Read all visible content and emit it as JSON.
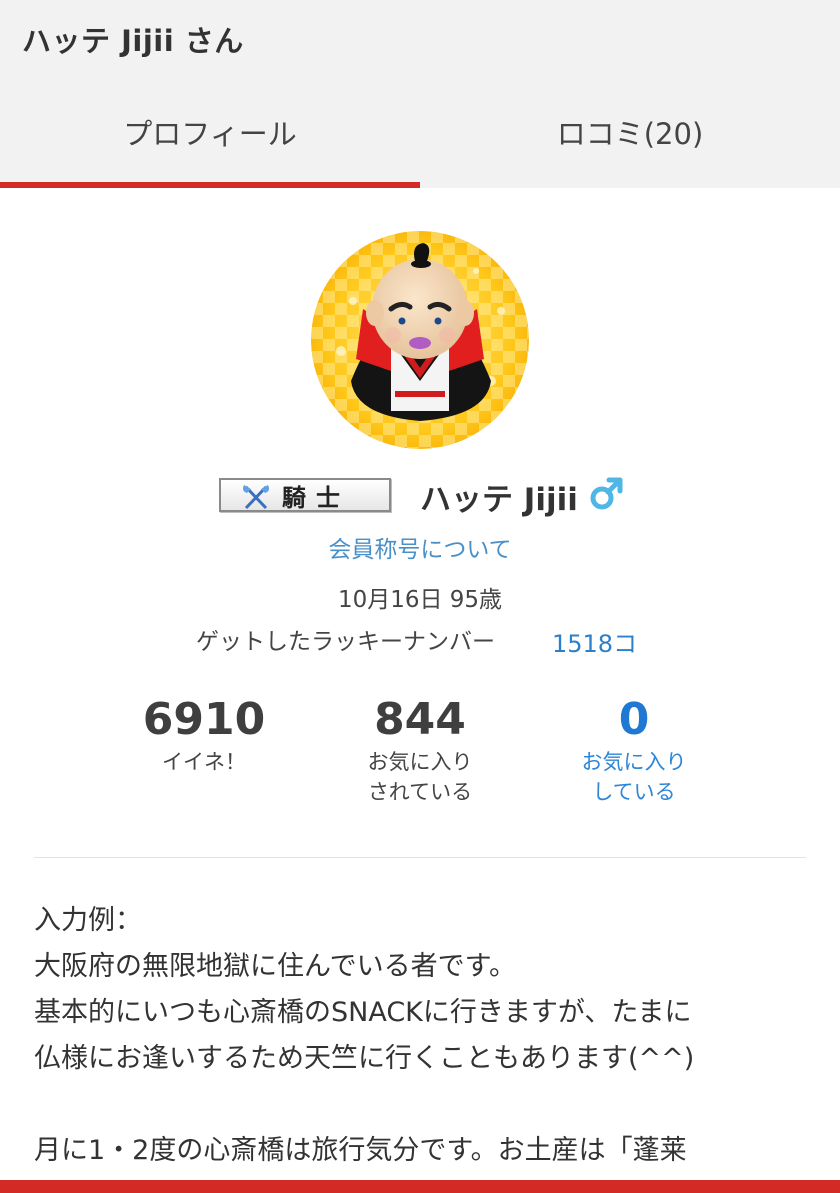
{
  "header": {
    "title": "ハッテ Jijii さん"
  },
  "tabs": [
    {
      "label": "プロフィール",
      "active": true
    },
    {
      "label": "ロコミ(20)",
      "active": false
    }
  ],
  "profile": {
    "rank_badge": "騎士",
    "name": "ハッテ Jijii",
    "gender_icon": "male-symbol-icon",
    "title_link": "会員称号について",
    "birthday": "10月16日 95歳",
    "lucky_label": "ゲットしたラッキーナンバー",
    "lucky_value": "1518コ"
  },
  "stats": {
    "likes": {
      "value": "6910",
      "label": "イイネ！"
    },
    "favorited": {
      "value": "844",
      "label_line1": "お気に入り",
      "label_line2": "されている"
    },
    "favoriting": {
      "value": "0",
      "label_line1": "お気に入り",
      "label_line2": "している"
    }
  },
  "bio": {
    "lines": [
      "入力例：",
      "大阪府の無限地獄に住んでいる者です。",
      "基本的にいつも心斎橋のSNACKに行きますが、たまに",
      "仏様にお逢いするため天竺に行くこともあります(^^)",
      "",
      "月に1・2度の心斎橋は旅行気分です。お土産は「蓬莱"
    ]
  },
  "colors": {
    "accent_red": "#d32a25",
    "link_blue": "#4a90c8",
    "stat_blue": "#1f78d1",
    "gender_blue": "#4fb6e6"
  }
}
